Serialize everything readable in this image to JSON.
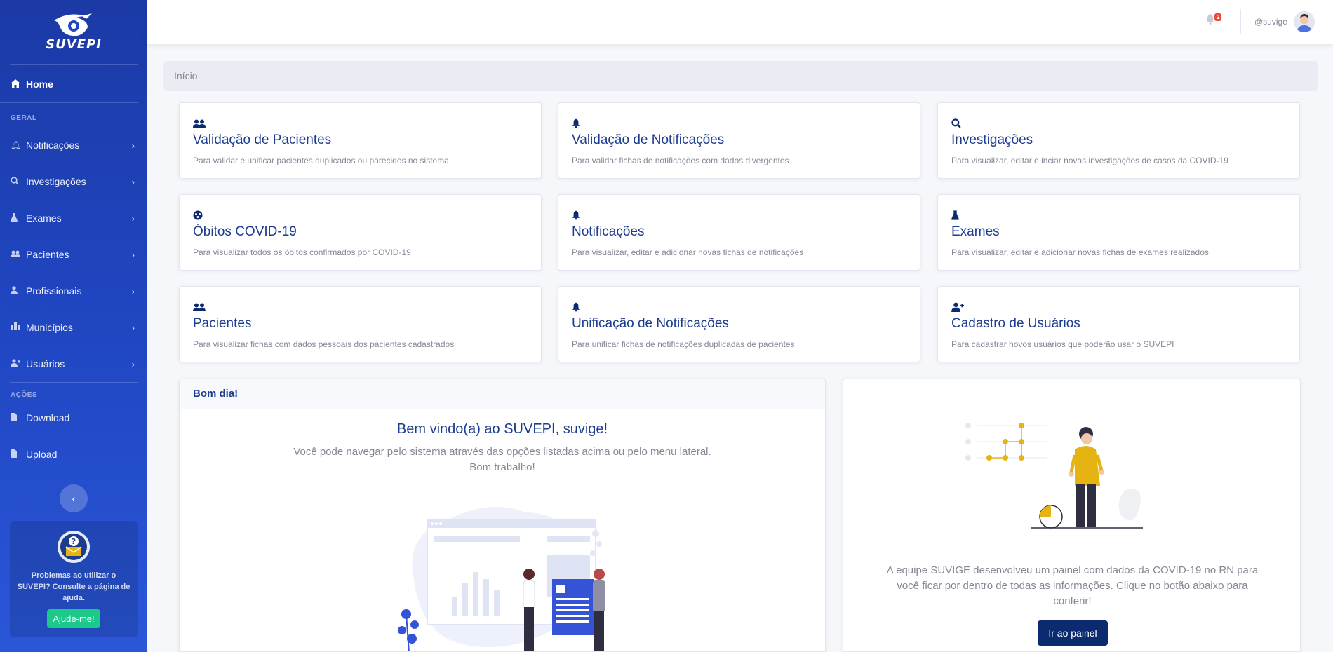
{
  "brand": {
    "name": "SUVEPI"
  },
  "sidebar": {
    "home_label": "Home",
    "section_geral": "GERAL",
    "items": [
      {
        "label": "Notificações",
        "icon": "bell-icon"
      },
      {
        "label": "Investigações",
        "icon": "search-icon"
      },
      {
        "label": "Exames",
        "icon": "flask-icon"
      },
      {
        "label": "Pacientes",
        "icon": "users-icon"
      },
      {
        "label": "Profissionais",
        "icon": "user-md-icon"
      },
      {
        "label": "Municípios",
        "icon": "building-icon"
      },
      {
        "label": "Usuários",
        "icon": "user-plus-icon"
      }
    ],
    "section_acoes": "AÇÕES",
    "actions": [
      {
        "label": "Download",
        "icon": "file-icon"
      },
      {
        "label": "Upload",
        "icon": "file-icon"
      }
    ],
    "help_text": "Problemas ao utilizar o SUVEPI? Consulte a página de ajuda.",
    "help_button": "Ajude-me!"
  },
  "topbar": {
    "notification_count": "2",
    "username": "@suvige"
  },
  "breadcrumb": {
    "current": "Início"
  },
  "cards": [
    {
      "title": "Validação de Pacientes",
      "desc": "Para validar e unificar pacientes duplicados ou parecidos no sistema",
      "icon": "users-icon"
    },
    {
      "title": "Validação de Notificações",
      "desc": "Para validar fichas de notificações com dados divergentes",
      "icon": "bell-icon"
    },
    {
      "title": "Investigações",
      "desc": "Para visualizar, editar e inciar novas investigações de casos da COVID-19",
      "icon": "search-icon"
    },
    {
      "title": "Óbitos COVID-19",
      "desc": "Para visualizar todos os óbitos confirmados por COVID-19",
      "icon": "virus-icon"
    },
    {
      "title": "Notificações",
      "desc": "Para visualizar, editar e adicionar novas fichas de notificações",
      "icon": "bell-icon"
    },
    {
      "title": "Exames",
      "desc": "Para visualizar, editar e adicionar novas fichas de exames realizados",
      "icon": "flask-icon"
    },
    {
      "title": "Pacientes",
      "desc": "Para visualizar fichas com dados pessoais dos pacientes cadastrados",
      "icon": "users-icon"
    },
    {
      "title": "Unificação de Notificações",
      "desc": "Para unificar fichas de notificações duplicadas de pacientes",
      "icon": "bell-icon"
    },
    {
      "title": "Cadastro de Usuários",
      "desc": "Para cadastrar novos usuários que poderão usar o SUVEPI",
      "icon": "user-plus-icon"
    }
  ],
  "welcome": {
    "header": "Bom dia!",
    "title": "Bem vindo(a) ao SUVEPI, suvige!",
    "line1": "Você pode navegar pelo sistema através das opções listadas acima ou pelo menu lateral.",
    "line2": "Bom trabalho!"
  },
  "painel": {
    "text": "A equipe SUVIGE desenvolveu um painel com dados da COVID-19 no RN para você ficar por dentro de todas as informações. Clique no botão abaixo para conferir!",
    "button": "Ir ao painel"
  },
  "colors": {
    "sidebar": "#2046c2",
    "primary_dark": "#0b2a6f",
    "card_title": "#1c3d8f",
    "accent_yellow": "#e6b412",
    "success": "#1cc88a",
    "badge": "#e74a3b"
  }
}
